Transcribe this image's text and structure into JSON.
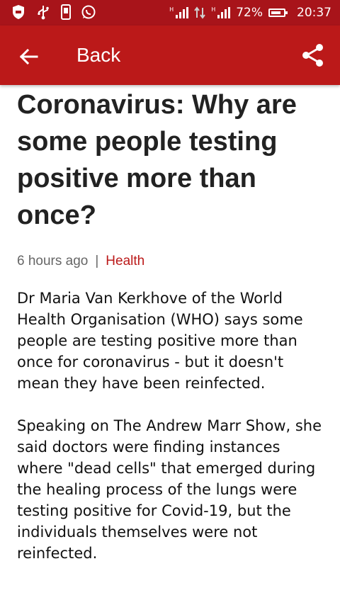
{
  "status_bar": {
    "icons": [
      "shield-icon",
      "usb-icon",
      "phone-icon",
      "whatsapp-icon",
      "signal-icon",
      "data-transfer-icon",
      "signal-icon",
      "battery-icon"
    ],
    "signal_tag": "H",
    "battery_percent": "72%",
    "battery_level": 0.72,
    "time": "20:37"
  },
  "app_bar": {
    "back_label": "Back",
    "back_icon": "arrow-left-icon",
    "share_icon": "share-icon",
    "color": "#bb1919"
  },
  "article": {
    "headline": "Coronavirus: Why are some people testing positive more than once?",
    "timestamp": "6 hours ago",
    "separator": "|",
    "section": "Health",
    "paragraphs": [
      "Dr Maria Van Kerkhove of the World Health Organisation (WHO) says some people are testing positive more than once for coronavirus - but it doesn't mean they have been reinfected.",
      "Speaking on The Andrew Marr Show, she said doctors were finding instances where \"dead cells\" that emerged during the healing process of the lungs were testing positive for Covid-19, but the individuals themselves were not reinfected."
    ]
  }
}
